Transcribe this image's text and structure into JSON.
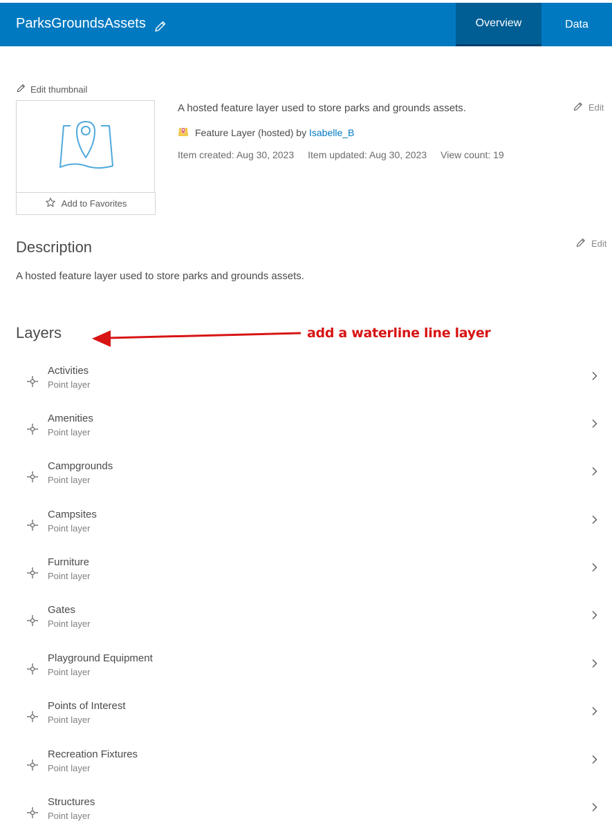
{
  "header": {
    "title": "ParksGroundsAssets",
    "tabs": [
      {
        "label": "Overview",
        "active": true
      },
      {
        "label": "Data",
        "active": false
      }
    ],
    "background_color": "#0079c1",
    "active_tab_color": "#005e95"
  },
  "item": {
    "edit_thumbnail_label": "Edit thumbnail",
    "add_to_favorites_label": "Add to Favorites",
    "summary": "A hosted feature layer used to store parks and grounds assets.",
    "type_prefix": "Feature Layer (hosted) by",
    "owner": "Isabelle_B",
    "created": "Item created: Aug 30, 2023",
    "updated": "Item updated: Aug 30, 2023",
    "view_count": "View count: 19",
    "edit_label": "Edit"
  },
  "description": {
    "title": "Description",
    "text": "A hosted feature layer used to store parks and grounds assets.",
    "edit_label": "Edit"
  },
  "layers": {
    "title": "Layers",
    "annotation": "add a waterline line layer",
    "annotation_color": "#d81414",
    "items": [
      {
        "name": "Activities",
        "type": "Point layer"
      },
      {
        "name": "Amenities",
        "type": "Point layer"
      },
      {
        "name": "Campgrounds",
        "type": "Point layer"
      },
      {
        "name": "Campsites",
        "type": "Point layer"
      },
      {
        "name": "Furniture",
        "type": "Point layer"
      },
      {
        "name": "Gates",
        "type": "Point layer"
      },
      {
        "name": "Playground Equipment",
        "type": "Point layer"
      },
      {
        "name": "Points of Interest",
        "type": "Point layer"
      },
      {
        "name": "Recreation Fixtures",
        "type": "Point layer"
      },
      {
        "name": "Structures",
        "type": "Point layer"
      }
    ]
  },
  "icons": {
    "header_edit": "pencil-icon",
    "thumbnail": "map-pin-icon",
    "favorite": "star-icon",
    "item_type": "feature-layer-icon",
    "layer": "point-layer-icon",
    "chevron": "chevron-right-icon"
  }
}
